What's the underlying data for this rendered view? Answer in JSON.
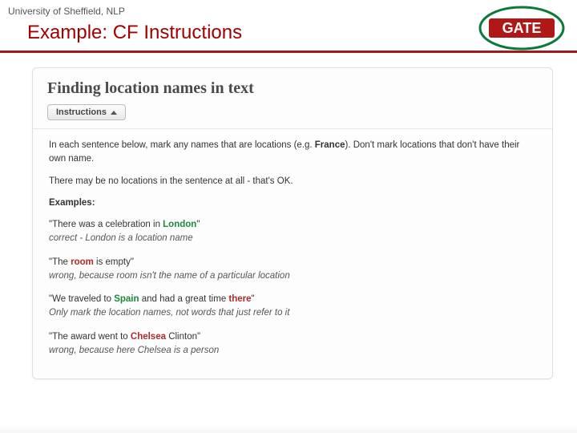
{
  "header": {
    "affiliation": "University of Sheffield, NLP",
    "title": "Example: CF Instructions",
    "logo_text": "GATE"
  },
  "panel": {
    "heading": "Finding location names in text",
    "instructions_button": "Instructions",
    "intro_line1_a": "In each sentence below, mark any names that are locations (e.g. ",
    "intro_line1_bold": "France",
    "intro_line1_b": "). Don't mark locations that don't have their own name.",
    "intro_line2": "There may be no locations in the sentence at all - that's OK.",
    "examples_label": "Examples:",
    "examples": [
      {
        "pre": "\"There was a celebration in ",
        "hl": "London",
        "hl_class": "hl-green",
        "post": "\"",
        "note": "correct - London is a location name"
      },
      {
        "pre": "\"The ",
        "hl": "room",
        "hl_class": "hl-red",
        "post": " is empty\"",
        "note": "wrong, because room isn't the name of a particular location"
      },
      {
        "pre": "\"We traveled to ",
        "hl": "Spain",
        "hl_class": "hl-green",
        "post_a": " and had a great time ",
        "hl2": "there",
        "hl2_class": "hl-red",
        "post_b": "\"",
        "note": "Only mark the location names, not words that just refer to it"
      },
      {
        "pre": "\"The award went to ",
        "hl": "Chelsea",
        "hl_class": "hl-red",
        "post": " Clinton\"",
        "note": "wrong, because here Chelsea is a person"
      }
    ]
  }
}
